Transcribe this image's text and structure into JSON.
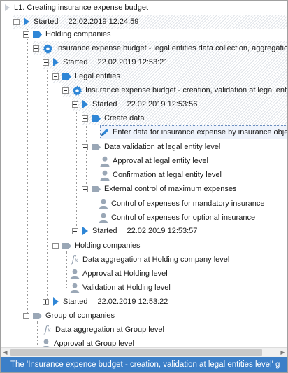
{
  "tree": {
    "root_label": "L1. Creating insurance expense budget",
    "started_1": {
      "label": "Started",
      "date": "22.02.2019 12:24:59"
    },
    "holding_companies_1": "Holding companies",
    "budget_collection": "Insurance expense budget - legal entities data collection, aggregation",
    "started_2": {
      "label": "Started",
      "date": "22.02.2019 12:53:21"
    },
    "legal_entities": "Legal entities",
    "budget_creation": "Insurance expense budget - creation, validation at legal entities",
    "started_3": {
      "label": "Started",
      "date": "22.02.2019 12:53:56"
    },
    "create_data": "Create data",
    "enter_data": "Enter data for insurance expense by insurance object",
    "data_validation": "Data validation at legal entity level",
    "approval_le": "Approval at legal entity level",
    "confirmation_le": "Confirmation at legal entity level",
    "external_control": "External control of maximum expenses",
    "control_mandatory": "Control of expenses for mandatory insurance",
    "control_optional": "Control of expenses for optional insurance",
    "started_4": {
      "label": "Started",
      "date": "22.02.2019 12:53:57"
    },
    "holding_companies_2": "Holding companies",
    "data_aggregation_holding": "Data aggregation at Holding company level",
    "approval_holding": "Approval at Holding level",
    "validation_holding": "Validation at Holding level",
    "started_5": {
      "label": "Started",
      "date": "22.02.2019 12:53:22"
    },
    "group_of_companies": "Group of companies",
    "data_aggregation_group": "Data aggregation at Group level",
    "approval_group": "Approval at Group level"
  },
  "status_bar": {
    "text": "The 'Insurance expence budget - creation, validation at legal entities level' g"
  },
  "colors": {
    "accent_blue": "#2f86d6",
    "status_blue": "#3c7fc8",
    "grey_icon": "#8e9bab"
  },
  "icons": [
    "chevron-right-icon",
    "expand-minus-icon",
    "expand-plus-icon",
    "flag-icon",
    "gear-icon",
    "user-icon",
    "function-icon",
    "pencil-icon"
  ]
}
